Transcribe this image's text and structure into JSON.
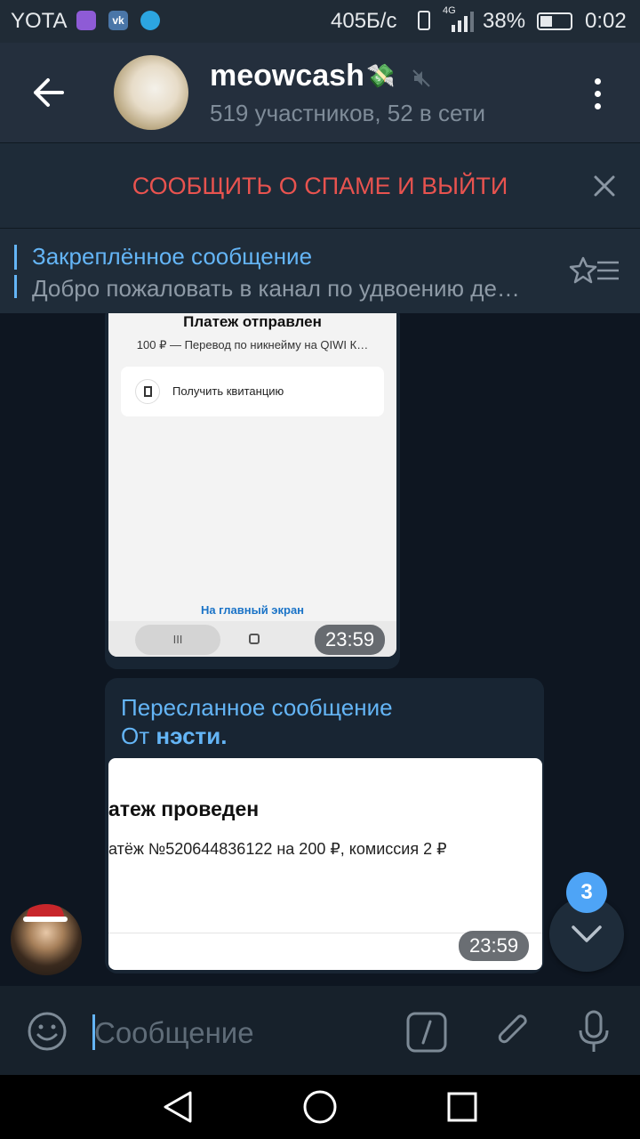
{
  "status_bar": {
    "carrier": "YOTA",
    "network_speed": "405Б/с",
    "network_type": "4G",
    "battery_percent": "38%",
    "time": "0:02"
  },
  "header": {
    "chat_title": "meowcash",
    "members_status": "519 участников, 52 в сети"
  },
  "spam_bar": {
    "report_label": "СООБЩИТЬ О СПАМЕ И ВЫЙТИ"
  },
  "pinned": {
    "title": "Закреплённое сообщение",
    "preview": "Добро пожаловать в канал по удвоению де…"
  },
  "messages": [
    {
      "screenshot": {
        "heading": "Платеж отправлен",
        "subtitle": "100 ₽ — Перевод по никнейму на QIWI К…",
        "receipt_button": "Получить квитанцию",
        "home_link": "На главный экран",
        "nav_glyph": "III"
      },
      "time": "23:59"
    },
    {
      "forward_title": "Пересланное сообщение",
      "from_prefix": "От ",
      "from_name": "нэсти.",
      "screenshot": {
        "heading": "атеж проведен",
        "detail": "атёж №520644836122 на 200 ₽, комиссия 2 ₽"
      },
      "time": "23:59"
    }
  ],
  "scroll_badge": {
    "unread_count": "3"
  },
  "input": {
    "placeholder": "Сообщение"
  },
  "colors": {
    "accent": "#64b5f6",
    "spam_red": "#e8534f",
    "badge_blue": "#4ea4f6",
    "bg": "#0e1621"
  }
}
